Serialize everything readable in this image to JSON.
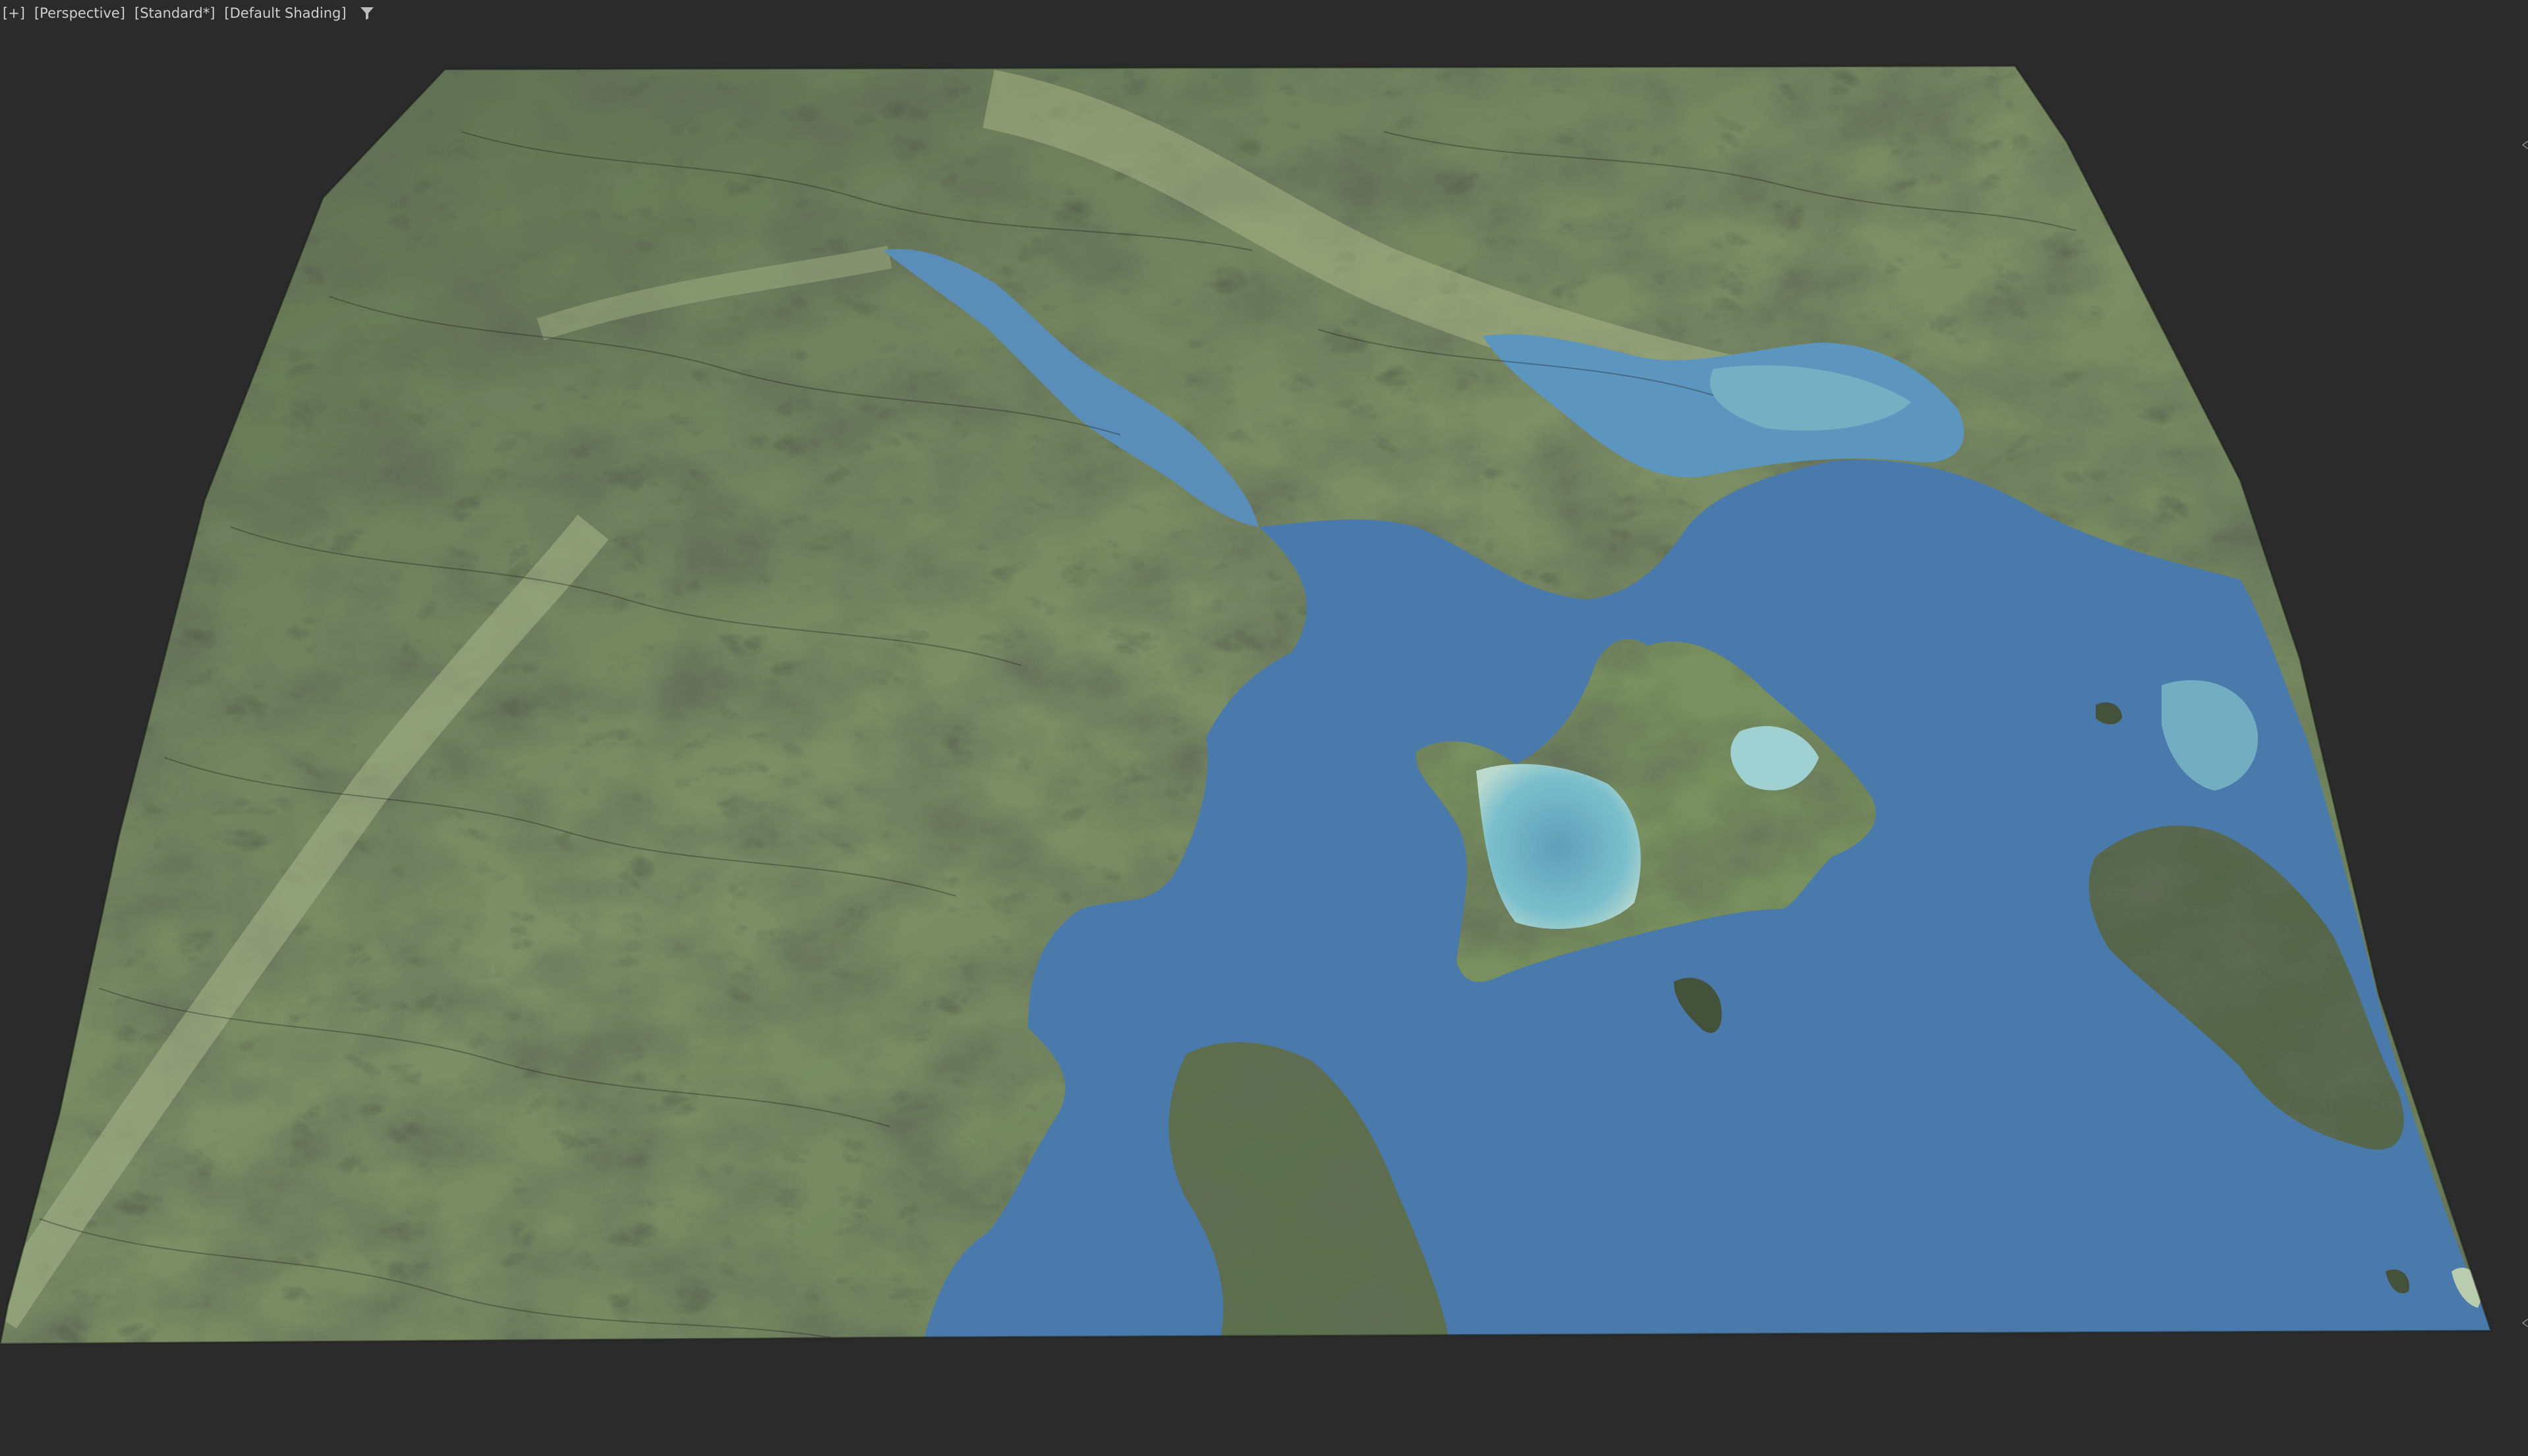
{
  "viewport": {
    "menu_label": "[+]",
    "view_label": "[Perspective]",
    "preset_label": "[Standard*]",
    "shading_label": "[Default Shading]",
    "filter_icon": "filter-funnel-icon"
  },
  "colors": {
    "background": "#2b2b2b",
    "ui_text": "#cfcfcf",
    "water_deep": "#4a7aab",
    "water_shallow": "#6fb4c6",
    "land_light": "#a9b889",
    "land_mid": "#6f8560",
    "land_dark": "#2c3526",
    "contour": "#1a2016"
  }
}
